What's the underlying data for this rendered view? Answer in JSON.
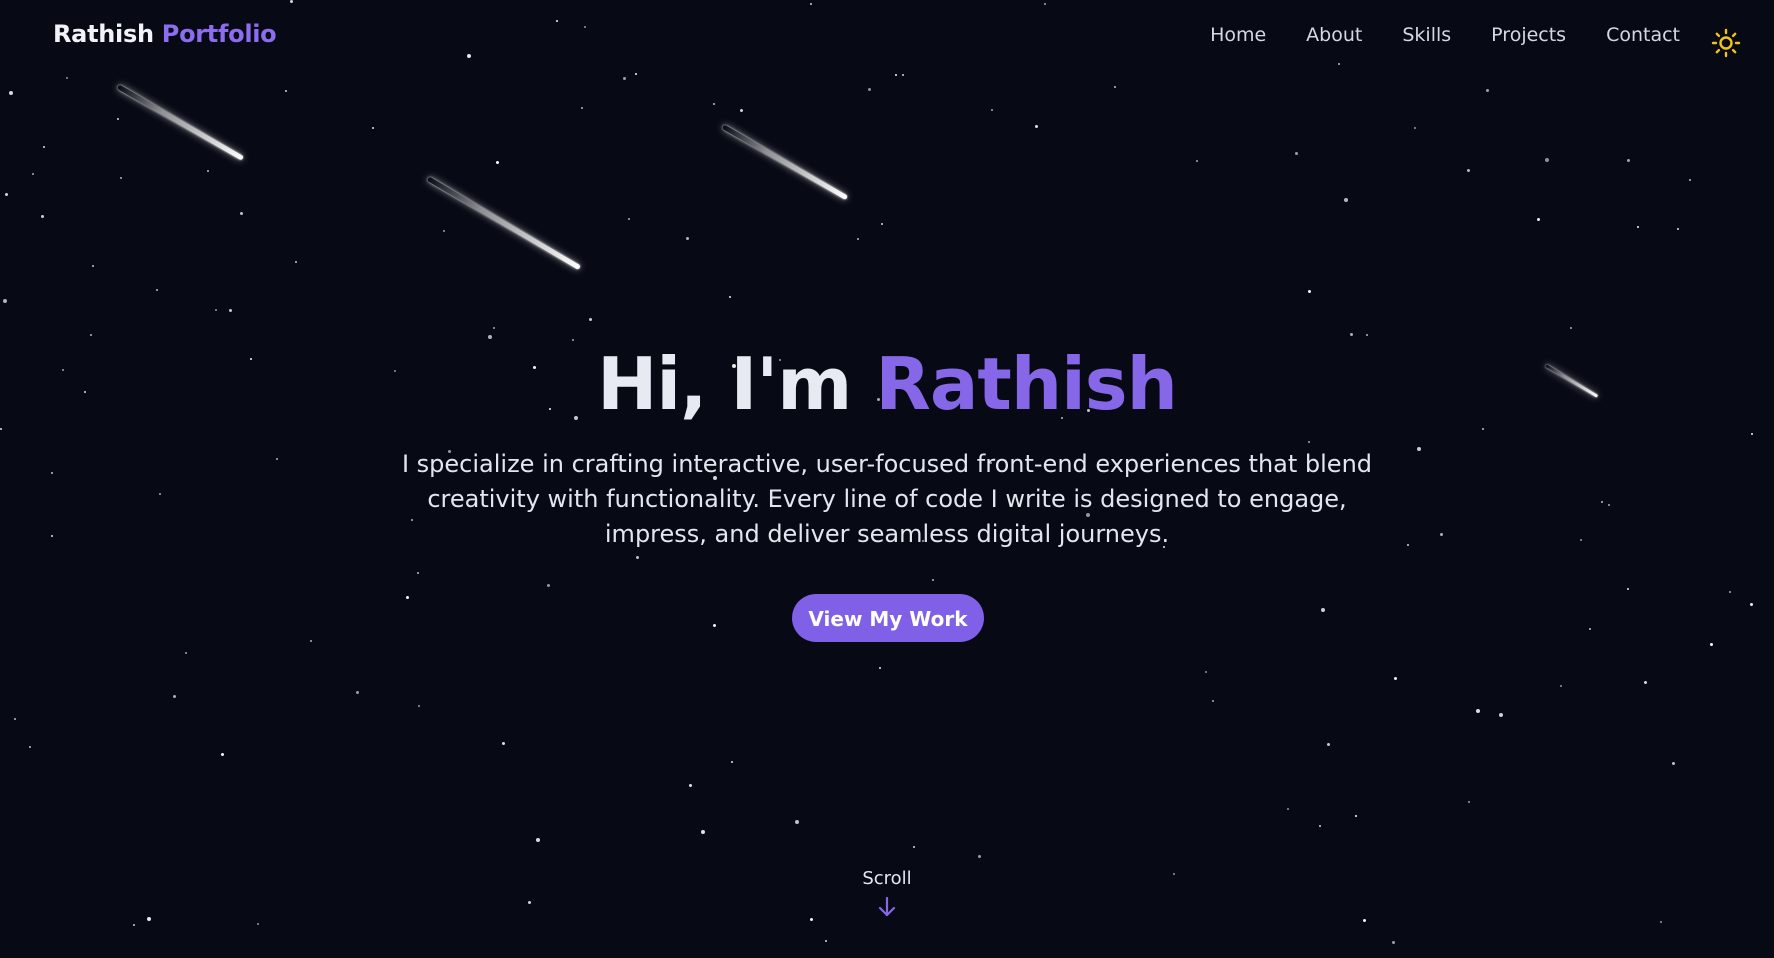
{
  "nav": {
    "brand_first": "Rathish",
    "brand_second": "Portfolio",
    "links": [
      "Home",
      "About",
      "Skills",
      "Projects",
      "Contact"
    ],
    "theme_toggle_icon": "sun-icon"
  },
  "hero": {
    "greeting": "Hi, I'm",
    "name": "Rathish",
    "description": "I specialize in crafting interactive, user-focused front-end experiences that blend creativity with functionality. Every line of code I write is designed to engage, impress, and deliver seamless digital journeys.",
    "cta_label": "View My Work"
  },
  "scroll": {
    "label": "Scroll",
    "icon": "arrow-down-icon"
  },
  "colors": {
    "background": "#070a15",
    "accent": "#8567e8",
    "sun": "#f2c417"
  }
}
